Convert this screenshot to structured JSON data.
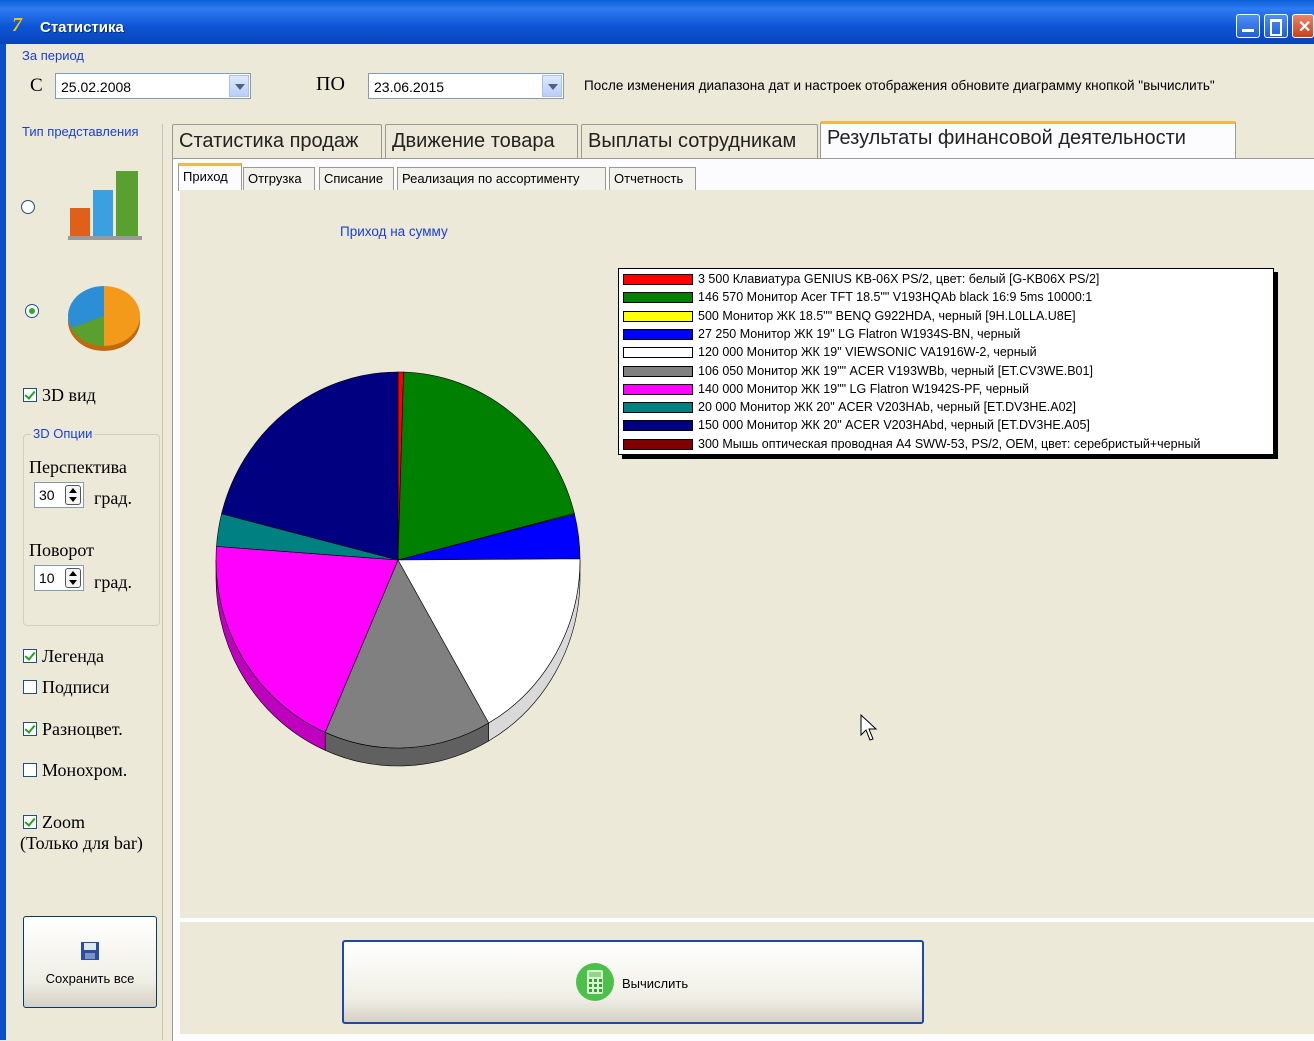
{
  "window": {
    "title": "Статистика"
  },
  "period": {
    "group_label": "За период",
    "from_label": "С",
    "from_value": "25.02.2008",
    "to_label": "ПО",
    "to_value": "23.06.2015",
    "hint": "После изменения диапазона дат и настроек отображения обновите диаграмму кнопкой \"вычислить\""
  },
  "view": {
    "type_label": "Тип представления",
    "bar_selected": false,
    "pie_selected": true,
    "view3d_label": "3D вид",
    "options_label": "3D Опции",
    "perspective_label": "Перспектива",
    "perspective_value": "30",
    "perspective_unit": "град.",
    "rotation_label": "Поворот",
    "rotation_value": "10",
    "rotation_unit": "град.",
    "legend_label": "Легенда",
    "captions_label": "Подписи",
    "multicolor_label": "Разноцвет.",
    "monochrome_label": "Монохром.",
    "zoom_label": "Zoom",
    "zoom_note": "(Только для bar)",
    "save_all_label": "Сохранить все"
  },
  "tabs": {
    "main": [
      "Статистика продаж",
      "Движение товара",
      "Выплаты сотрудникам",
      "Результаты финансовой деятельности"
    ],
    "sub": [
      "Приход",
      "Отгрузка",
      "Списание",
      "Реализация по ассортименту",
      "Отчетность"
    ]
  },
  "calc_label": "Вычислить",
  "chart_data": {
    "type": "pie",
    "title": "Приход на сумму",
    "legend_position": "top-right",
    "series": [
      {
        "label": "3 500 Клавиатура GENIUS KB-06X PS/2, цвет: белый [G-KB06X PS/2]",
        "value": 3500,
        "color": "#ff0000"
      },
      {
        "label": "146 570 Монитор Acer TFT 18.5\"\" V193HQAb black 16:9 5ms 10000:1",
        "value": 146570,
        "color": "#008000"
      },
      {
        "label": "500 Монитор ЖК 18.5\"\" BENQ G922HDA, черный [9H.L0LLA.U8E]",
        "value": 500,
        "color": "#ffff00"
      },
      {
        "label": "27 250 Монитор ЖК 19\" LG Flatron W1934S-BN, черный",
        "value": 27250,
        "color": "#0000ff"
      },
      {
        "label": "120 000 Монитор ЖК 19\" VIEWSONIC VA1916W-2, черный",
        "value": 120000,
        "color": "#ffffff"
      },
      {
        "label": "106 050 Монитор ЖК 19\"\" ACER V193WBb, черный [ET.CV3WE.B01]",
        "value": 106050,
        "color": "#808080"
      },
      {
        "label": "140 000 Монитор ЖК 19\"\" LG Flatron W1942S-PF, черный",
        "value": 140000,
        "color": "#ff00ff"
      },
      {
        "label": "20 000 Монитор ЖК 20\" ACER V203HAb, черный [ET.DV3HE.A02]",
        "value": 20000,
        "color": "#008080"
      },
      {
        "label": "150 000 Монитор ЖК 20\" ACER V203HAbd, черный [ET.DV3HE.A05]",
        "value": 150000,
        "color": "#000080"
      },
      {
        "label": "300 Мышь оптическая проводная A4 SWW-53, PS/2, OEM, цвет: серебристый+черный",
        "value": 300,
        "color": "#800000"
      }
    ]
  }
}
